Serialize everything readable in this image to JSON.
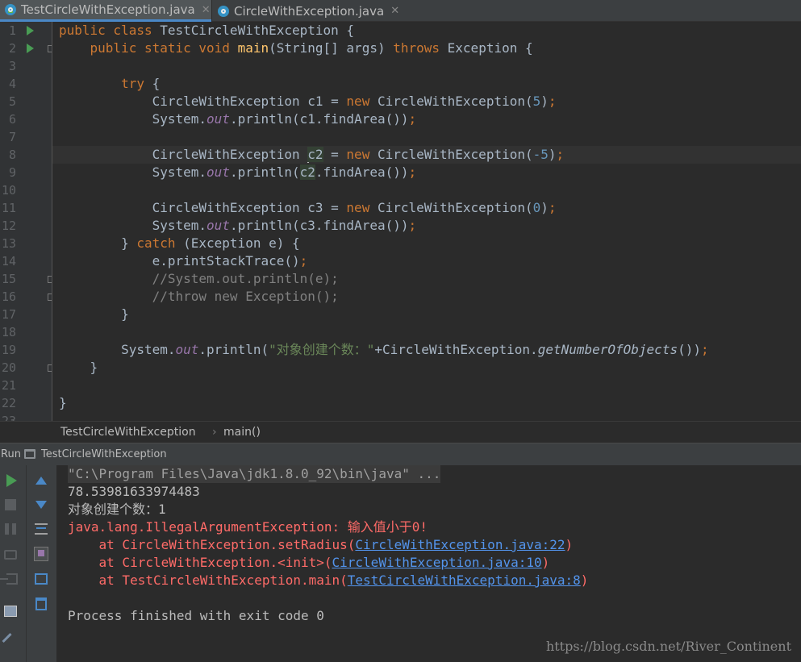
{
  "tabs": [
    {
      "label": "TestCircleWithException.java",
      "active": true
    },
    {
      "label": "CircleWithException.java",
      "active": false
    }
  ],
  "line_numbers": [
    "1",
    "2",
    "3",
    "4",
    "5",
    "6",
    "7",
    "8",
    "9",
    "10",
    "11",
    "12",
    "13",
    "14",
    "15",
    "16",
    "17",
    "18",
    "19",
    "20",
    "21",
    "22",
    "23"
  ],
  "code": {
    "l1": {
      "a": "public class ",
      "b": "TestCircleWithException {"
    },
    "l2": {
      "a": "    public static void ",
      "b": "main",
      "c": "(String[] args) ",
      "d": "throws ",
      "e": "Exception {"
    },
    "l4": {
      "a": "        try",
      "b": " {"
    },
    "l5": {
      "a": "            CircleWithException c1 = ",
      "b": "new ",
      "c": "CircleWithException(",
      "d": "5",
      "e": ")",
      "f": ";"
    },
    "l6": {
      "a": "            System.",
      "b": "out",
      "c": ".println(c1.findArea())",
      "d": ";"
    },
    "l8": {
      "a": "            CircleWithException ",
      "b": "c2",
      "c": " = ",
      "d": "new ",
      "e": "CircleWithException(",
      "f": "-5",
      "g": ")",
      "h": ";"
    },
    "l9": {
      "a": "            System.",
      "b": "out",
      "c": ".println(",
      "d": "c2",
      "e": ".findArea())",
      "f": ";"
    },
    "l11": {
      "a": "            CircleWithException c3 = ",
      "b": "new ",
      "c": "CircleWithException(",
      "d": "0",
      "e": ")",
      "f": ";"
    },
    "l12": {
      "a": "            System.",
      "b": "out",
      "c": ".println(c3.findArea())",
      "d": ";"
    },
    "l13": {
      "a": "        } ",
      "b": "catch ",
      "c": "(Exception e) {"
    },
    "l14": {
      "a": "            e.printStackTrace()",
      "b": ";"
    },
    "l15": {
      "a": "            //System.out.println(e);"
    },
    "l16": {
      "a": "            //throw new Exception();"
    },
    "l17": {
      "a": "        }"
    },
    "l19": {
      "a": "        System.",
      "b": "out",
      "c": ".println(",
      "d": "\"对象创建个数：\"",
      "e": "+CircleWithException.",
      "f": "getNumberOfObjects",
      "g": "())",
      "h": ";"
    },
    "l20": {
      "a": "    }"
    },
    "l22": {
      "a": "}"
    }
  },
  "breadcrumb": {
    "class": "TestCircleWithException",
    "method": "main()",
    "separator": "›"
  },
  "run_panel": {
    "label": "Run",
    "config": "TestCircleWithException"
  },
  "toolbar_icons": [
    "run-icon",
    "stop-icon",
    "pause-icon",
    "camera-icon",
    "login-icon",
    "layout-icon",
    "pin-icon",
    "up-arrow-icon",
    "down-arrow-icon",
    "soft-wrap-icon",
    "scroll-to-end-icon",
    "print-icon",
    "trash-icon"
  ],
  "console": {
    "cmd": "\"C:\\Program Files\\Java\\jdk1.8.0_92\\bin\\java\" ...",
    "out1": "78.53981633974483",
    "out2": "对象创建个数：1",
    "err1": "java.lang.IllegalArgumentException: 输入值小于0!",
    "st1_pre": "    at CircleWithException.setRadius(",
    "st1_link": "CircleWithException.java:22",
    "st2_pre": "    at CircleWithException.<init>(",
    "st2_link": "CircleWithException.java:10",
    "st3_pre": "    at TestCircleWithException.main(",
    "st3_link": "TestCircleWithException.java:8",
    "paren": ")",
    "finished": "Process finished with exit code 0"
  },
  "watermark": "https://blog.csdn.net/River_Continent",
  "colors": {
    "keyword": "#cc7832",
    "function": "#ffc66d",
    "number": "#6897bb",
    "static_field": "#9876aa",
    "string": "#6a8759",
    "comment": "#808080",
    "error": "#ff6b68",
    "link": "#5394ec"
  }
}
